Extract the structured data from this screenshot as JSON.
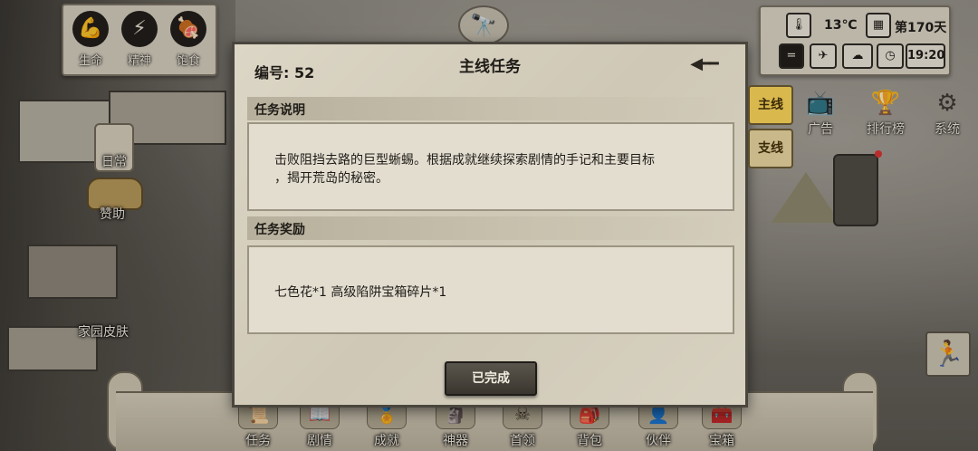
{
  "stats": [
    {
      "icon": "arm-icon",
      "glyph": "💪",
      "label": "生命"
    },
    {
      "icon": "lightning-head-icon",
      "glyph": "⚡",
      "label": "精神"
    },
    {
      "icon": "stomach-icon",
      "glyph": "🍖",
      "label": "饱食"
    }
  ],
  "left_side": {
    "daily_label": "日常",
    "sponsor_label": "赞助",
    "home_skin_label": "家园皮肤"
  },
  "status": {
    "temperature": "13℃",
    "day": "第170天",
    "time": "19:20"
  },
  "right_menu": [
    {
      "icon": "ad-icon",
      "glyph": "📺",
      "label": "广告"
    },
    {
      "icon": "trophy-icon",
      "glyph": "🏆",
      "label": "排行榜"
    },
    {
      "icon": "gear-icon",
      "glyph": "⚙",
      "label": "系统"
    }
  ],
  "modal": {
    "number_label": "编号: 52",
    "title": "主线任务",
    "description_heading": "任务说明",
    "description_line1": "击败阻挡去路的巨型蜥蜴。根据成就继续探索剧情的手记和主要目标",
    "description_line2": "，揭开荒岛的秘密。",
    "reward_heading": "任务奖励",
    "reward_text": "七色花*1 高级陷阱宝箱碎片*1",
    "button_label": "已完成"
  },
  "tabs": {
    "main": "主线",
    "side": "支线"
  },
  "bottom_nav": [
    {
      "icon": "quest-icon",
      "glyph": "📜",
      "label": "任务"
    },
    {
      "icon": "story-icon",
      "glyph": "📖",
      "label": "剧情"
    },
    {
      "icon": "achievement-icon",
      "glyph": "🏅",
      "label": "成就"
    },
    {
      "icon": "artifact-icon",
      "glyph": "🗿",
      "label": "神器"
    },
    {
      "icon": "boss-icon",
      "glyph": "☠",
      "label": "首领"
    },
    {
      "icon": "backpack-icon",
      "glyph": "🎒",
      "label": "背包"
    },
    {
      "icon": "companion-icon",
      "glyph": "👤",
      "label": "伙伴"
    },
    {
      "icon": "chest-icon",
      "glyph": "🧰",
      "label": "宝箱"
    }
  ]
}
